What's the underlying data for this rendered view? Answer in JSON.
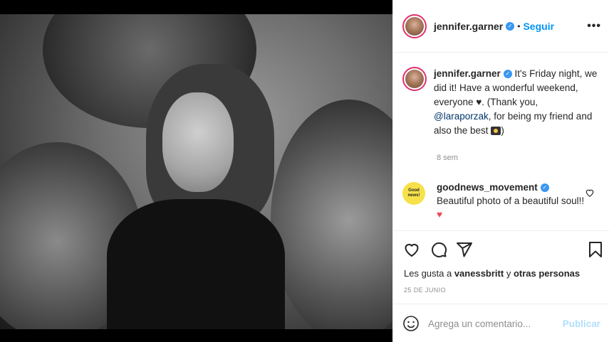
{
  "post": {
    "username": "jennifer.garner",
    "follow_label": "Seguir",
    "dot": "•",
    "more_label": "•••"
  },
  "caption": {
    "username": "jennifer.garner",
    "text_part1": " It's Friday night, we did it! Have a wonderful weekend, everyone ♥. (Thank you, ",
    "mention": "@laraporzak",
    "text_part2": ", for being my friend and also the best ",
    "text_part3": ")"
  },
  "time_ago": "8 sem",
  "comment": {
    "avatar_text": "Good news!",
    "username": "goodnews_movement",
    "text": " Beautiful photo of a beautiful soul!! ",
    "emoji": "♥"
  },
  "likes": {
    "prefix": "Les gusta a ",
    "user": "vanessbritt",
    "middle": " y ",
    "others": "otras personas"
  },
  "date": "25 DE JUNIO",
  "add_comment": {
    "placeholder": "Agrega un comentario...",
    "publish_label": "Publicar"
  },
  "colors": {
    "link": "#0095f6",
    "verified": "#3897f0",
    "heart": "#ed4956"
  },
  "icons": [
    "verified-badge-icon",
    "more-options-icon",
    "heart-icon",
    "comment-icon",
    "share-icon",
    "bookmark-icon",
    "emoji-icon",
    "small-heart-icon",
    "camera-emoji-icon"
  ]
}
